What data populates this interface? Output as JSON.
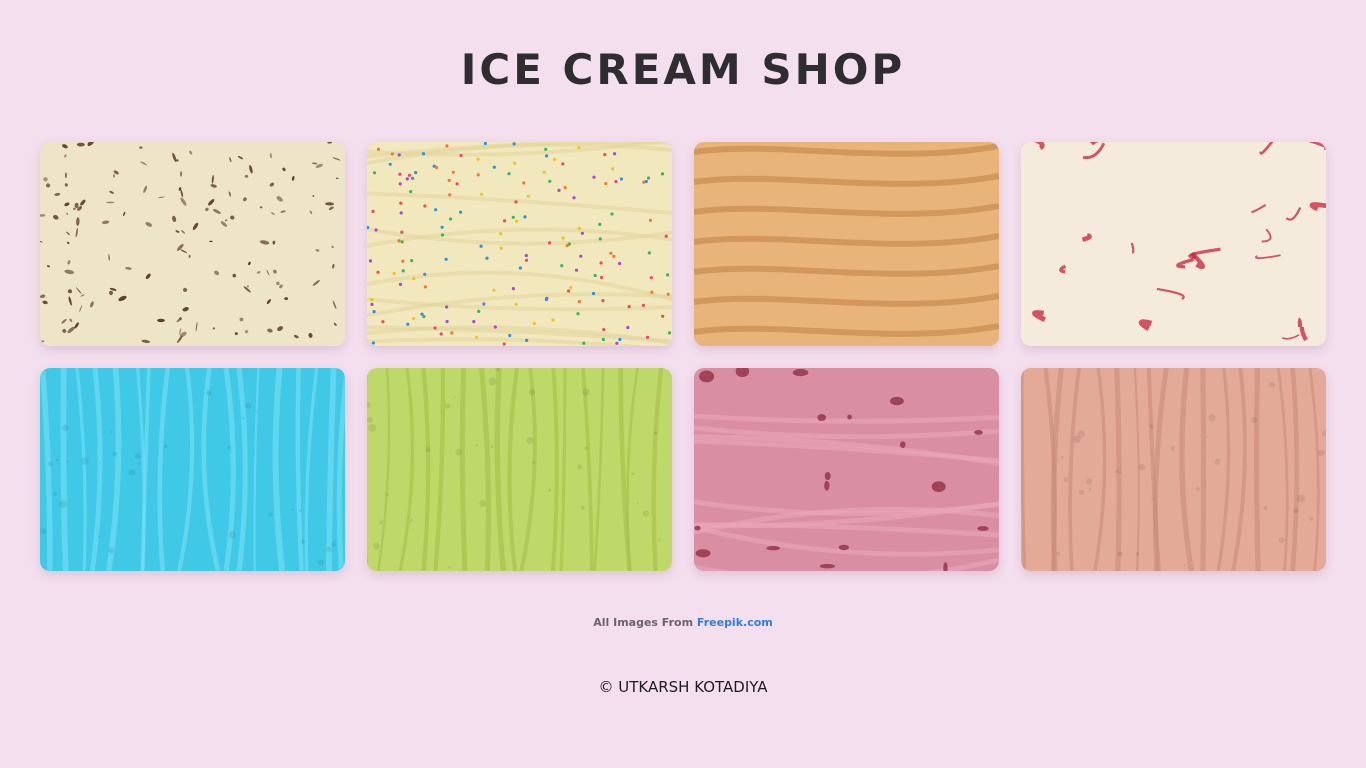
{
  "header": {
    "title": "ICE CREAM SHOP"
  },
  "gallery": {
    "tiles": [
      {
        "flavor_icon": "ice-cream-texture",
        "base_color": "#eee4c8",
        "accent_color": "#5a3a2a",
        "pattern": "chips"
      },
      {
        "flavor_icon": "ice-cream-texture",
        "base_color": "#f2e8bd",
        "accent_color": "#e84a6a",
        "pattern": "sprinkles"
      },
      {
        "flavor_icon": "ice-cream-texture",
        "base_color": "#e8b47a",
        "accent_color": "#c98b4e",
        "pattern": "waves"
      },
      {
        "flavor_icon": "ice-cream-texture",
        "base_color": "#f4ebdc",
        "accent_color": "#c8203a",
        "pattern": "swirl"
      },
      {
        "flavor_icon": "ice-cream-texture",
        "base_color": "#3fc9e6",
        "accent_color": "#7ee0f2",
        "pattern": "ridges"
      },
      {
        "flavor_icon": "ice-cream-texture",
        "base_color": "#bfd86a",
        "accent_color": "#a0c044",
        "pattern": "ridges"
      },
      {
        "flavor_icon": "ice-cream-texture",
        "base_color": "#d98ea2",
        "accent_color": "#8c2a3e",
        "pattern": "chunks"
      },
      {
        "flavor_icon": "ice-cream-texture",
        "base_color": "#e4aa98",
        "accent_color": "#c98876",
        "pattern": "ridges"
      }
    ]
  },
  "credit": {
    "prefix": "All Images From",
    "link_label": "Freepik.com"
  },
  "footer": {
    "copyright": "© UTKARSH KOTADIYA"
  }
}
